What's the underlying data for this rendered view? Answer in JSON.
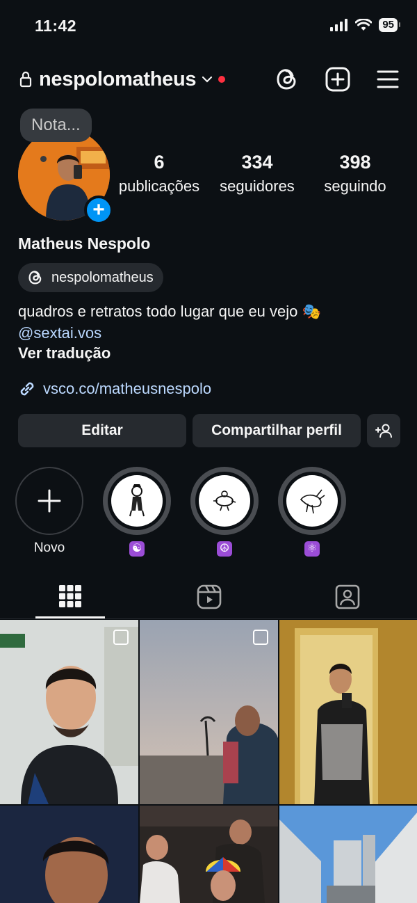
{
  "status_bar": {
    "time": "11:42",
    "battery": "95"
  },
  "header": {
    "username": "nespolomatheus"
  },
  "profile": {
    "note_placeholder": "Nota...",
    "stats": [
      {
        "value": "6",
        "label": "publicações"
      },
      {
        "value": "334",
        "label": "seguidores"
      },
      {
        "value": "398",
        "label": "seguindo"
      }
    ],
    "full_name": "Matheus Nespolo",
    "threads_handle": "nespolomatheus",
    "bio_line": "quadros e retratos todo lugar que eu vejo 🎭",
    "bio_mention": "@sextai.vos",
    "translate_label": "Ver tradução",
    "link": "vsco.co/matheusnespolo"
  },
  "actions": {
    "edit_label": "Editar",
    "share_label": "Compartilhar perfil"
  },
  "highlights": {
    "new_label": "Novo",
    "items": [
      {
        "label": "☯"
      },
      {
        "label": "☮"
      },
      {
        "label": "⚛"
      }
    ]
  },
  "colors": {
    "background": "#0c1014",
    "accent": "#0095f6",
    "notify": "#ff3040"
  }
}
